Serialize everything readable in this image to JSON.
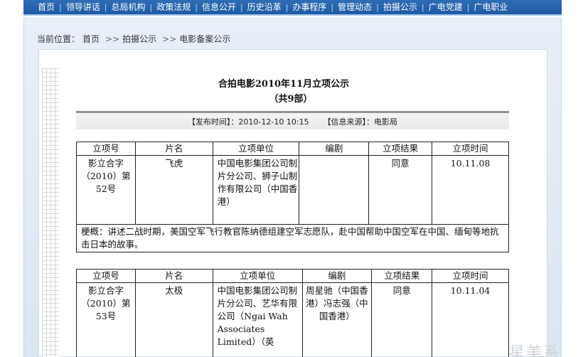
{
  "nav": {
    "items": [
      "首页",
      "领导讲话",
      "总局机构",
      "政策法规",
      "信息公开",
      "历史沿革",
      "办事程序",
      "管理动态",
      "拍摄公示",
      "广电党建",
      "广电职业"
    ]
  },
  "breadcrumb": {
    "label": "当前位置：",
    "home": "首页",
    "arrow": ">>",
    "level1": "拍摄公示",
    "level2": "电影备案公示"
  },
  "article": {
    "title": "合拍电影2010年11月立项公示",
    "subtitle": "（共9部）",
    "publish_time": "【发布时间】：2010-12-10 10:15",
    "source": "【信息来源】：电影局"
  },
  "table_headers": [
    "立项号",
    "片名",
    "立项单位",
    "编剧",
    "立项结果",
    "立项时间"
  ],
  "projects": [
    {
      "number": "影立合字（2010）第52号",
      "title": "飞虎",
      "unit": "中国电影集团公司制片分公司、狮子山制作有限公司（中国香港）",
      "writer": "",
      "result": "同意",
      "date": "10.11.08",
      "summary": "梗概：讲述二战时期，美国空军飞行教官陈纳德组建空军志愿队，赴中国帮助中国空军在中国、缅甸等地抗击日本的故事。"
    },
    {
      "number": "影立合字（2010）第53号",
      "title": "太极",
      "unit": "中国电影集团公司制片分公司、艺华有限公司（Ngai Wah Associates Limited）（英",
      "writer": "周星驰（中国香港）冯志强（中国香港）",
      "result": "同意",
      "date": "10.11.04"
    }
  ],
  "watermark": "星美系"
}
